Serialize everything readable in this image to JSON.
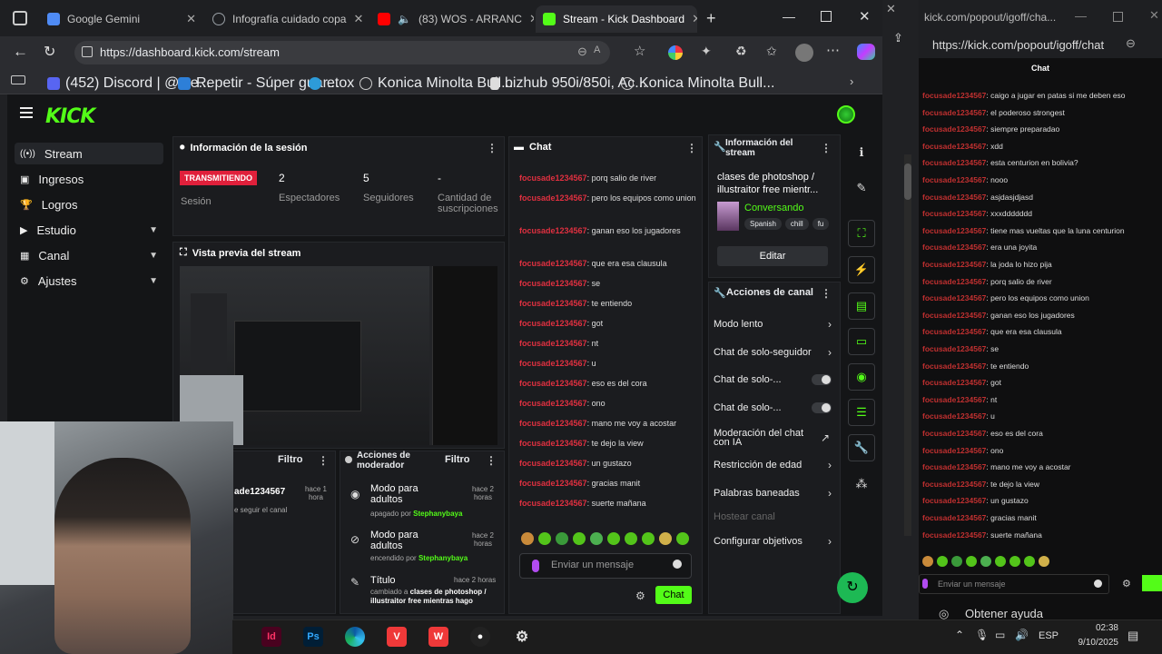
{
  "browser": {
    "tabs": [
      {
        "label": "Google Gemini",
        "color": "#4f8bf5"
      },
      {
        "label": "Infografía cuidado copa",
        "color": "#9aa0a6"
      },
      {
        "label": "(83) WOS - ARRANC",
        "color": "#ff0000"
      },
      {
        "label": "Stream - Kick Dashboard",
        "color": "#53fc18"
      }
    ],
    "url": "https://dashboard.kick.com/stream",
    "bookmarks": [
      "(452) Discord | @ste...",
      "Repetir - Súper guar...",
      "etox",
      "Konica Minolta Bull...",
      "bizhub 950i/850i, Ac...",
      "Konica Minolta Bull..."
    ]
  },
  "kick": {
    "logo": "KICK",
    "nav": [
      {
        "label": "Stream",
        "expandable": false
      },
      {
        "label": "Ingresos",
        "expandable": false
      },
      {
        "label": "Logros",
        "expandable": false
      },
      {
        "label": "Estudio",
        "expandable": true
      },
      {
        "label": "Canal",
        "expandable": true
      },
      {
        "label": "Ajustes",
        "expandable": true
      }
    ],
    "session": {
      "title": "Información de la sesión",
      "status": "TRANSMITIENDO",
      "status_label": "Sesión",
      "viewers": "2",
      "viewers_label": "Espectadores",
      "followers": "5",
      "followers_label": "Seguidores",
      "subs": "-",
      "subs_label": "Cantidad de suscripciones"
    },
    "preview_title": "Vista previa del stream",
    "activity": {
      "filter": "Filtro",
      "user": "ade1234567",
      "time": "hace 1 hora",
      "note": "e seguir el canal"
    },
    "mod_actions": {
      "title": "Acciones de moderador",
      "filter": "Filtro",
      "items": [
        {
          "title": "Modo para adultos",
          "detail": "apagado por",
          "user": "Stephanybaya",
          "time": "hace 2 horas"
        },
        {
          "title": "Modo para adultos",
          "detail": "encendido por",
          "user": "Stephanybaya",
          "time": "hace 2 horas"
        },
        {
          "title": "Título",
          "detail": "cambiado a",
          "value": "clases de photoshop / illustraitor free mientras hago",
          "time": "hace 2 horas"
        }
      ]
    },
    "chat": {
      "title": "Chat",
      "user": "focusade1234567",
      "messages": [
        "porq salio de river",
        "pero los equipos como union",
        "ganan eso los jugadores",
        "que era esa clausula",
        "se",
        "te entiendo",
        "got",
        "nt",
        "u",
        "eso es del cora",
        "ono",
        "mano me voy a acostar",
        "te dejo la view",
        "un gustazo",
        "gracias manit",
        "suerte mañana"
      ],
      "placeholder": "Enviar un mensaje",
      "send": "Chat"
    },
    "stream_info": {
      "title": "Información del stream",
      "stream_title": "clases de photoshop / illustraitor free mientr...",
      "category": "Conversando",
      "tags": [
        "Spanish",
        "chill",
        "fu"
      ],
      "edit": "Editar"
    },
    "channel_actions": {
      "title": "Acciones de canal",
      "items": [
        {
          "label": "Modo lento",
          "kind": "arrow"
        },
        {
          "label": "Chat de solo-seguidor",
          "kind": "arrow"
        },
        {
          "label": "Chat de solo-...",
          "kind": "toggle"
        },
        {
          "label": "Chat de solo-...",
          "kind": "toggle"
        },
        {
          "label": "Moderación del chat con IA",
          "kind": "link"
        },
        {
          "label": "Restricción de edad",
          "kind": "arrow"
        },
        {
          "label": "Palabras baneadas",
          "kind": "arrow"
        },
        {
          "label": "Hostear canal",
          "kind": "disabled"
        },
        {
          "label": "Configurar objetivos",
          "kind": "arrow"
        }
      ]
    }
  },
  "popout": {
    "url_short": "kick.com/popout/igoff/cha...",
    "url": "https://kick.com/popout/igoff/chat",
    "header": "Chat",
    "user": "focusade1234567",
    "messages": [
      "caigo a jugar en patas si me deben eso",
      "el poderoso strongest",
      "siempre preparadao",
      "xdd",
      "esta centurion en bolivia?",
      "nooo",
      "asjdasjdjasd",
      "xxxddddddd",
      "tiene mas vueltas que la luna centurion",
      "era una joyita",
      "la joda lo hizo pija",
      "porq salio de river",
      "pero los equipos como union",
      "ganan eso los jugadores",
      "que era esa clausula",
      "se",
      "te entiendo",
      "got",
      "nt",
      "u",
      "eso es del cora",
      "ono",
      "mano me voy a acostar",
      "te dejo la view",
      "un gustazo",
      "gracias manit",
      "suerte mañana"
    ],
    "placeholder": "Enviar un mensaje",
    "help": "Obtener ayuda"
  },
  "taskbar": {
    "lang": "ESP",
    "time": "02:38",
    "date": "9/10/2025"
  }
}
